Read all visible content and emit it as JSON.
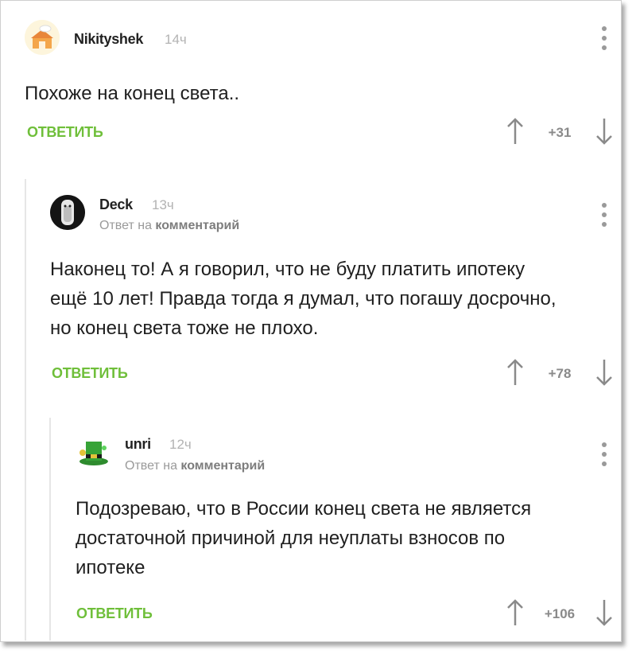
{
  "comments": [
    {
      "username": "Nikityshek",
      "time": "14ч",
      "text": "Похоже на конец света..",
      "reply_label": "ОТВЕТИТЬ",
      "score": "+31"
    },
    {
      "username": "Deck",
      "time": "13ч",
      "reply_to_prefix": "Ответ на",
      "reply_to_link": "комментарий",
      "text_lines": [
        "Наконец то! А я говорил, что не буду платить ипотеку",
        "ещё 10 лет! Правда тогда я думал, что погашу досрочно,",
        "но конец света тоже не плохо."
      ],
      "reply_label": "ОТВЕТИТЬ",
      "score": "+78"
    },
    {
      "username": "unri",
      "time": "12ч",
      "reply_to_prefix": "Ответ на",
      "reply_to_link": "комментарий",
      "text_lines": [
        "Подозреваю, что в России конец света не является",
        "достаточной причиной для неуплаты взносов по",
        "ипотеке"
      ],
      "reply_label": "ОТВЕТИТЬ",
      "score": "+106"
    }
  ],
  "colors": {
    "accent": "#6fbf3a",
    "muted": "#9a9a9a",
    "text": "#1f1f1f"
  },
  "icons": {
    "upvote": "arrow-up-icon",
    "downvote": "arrow-down-icon",
    "menu": "more-vertical-icon"
  }
}
